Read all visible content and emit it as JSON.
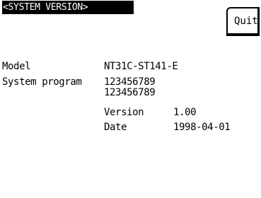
{
  "header": {
    "title": "<SYSTEM VERSION>",
    "quit_label": "Quit"
  },
  "info": {
    "model_label": "Model",
    "model_value": "NT31C-ST141-E",
    "system_program_label": "System program",
    "system_program_line1": "123456789",
    "system_program_line2": "123456789",
    "version_label": "Version",
    "version_value": "1.00",
    "date_label": "Date",
    "date_value": "1998-04-01"
  }
}
